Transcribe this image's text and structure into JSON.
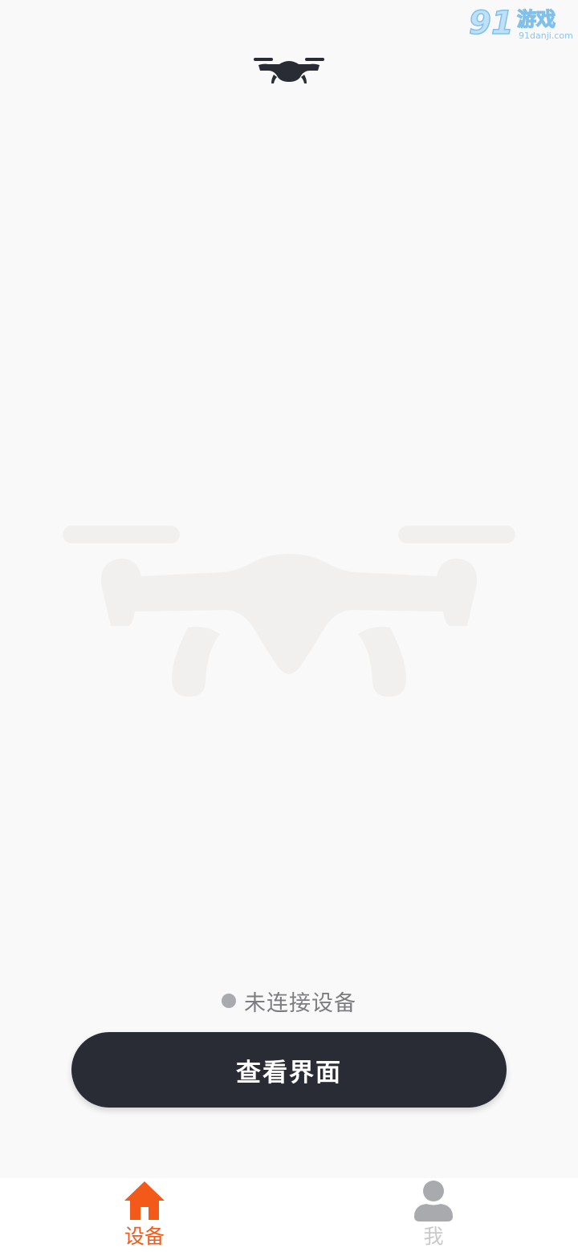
{
  "watermark": {
    "brand_number": "91",
    "brand_text": "游戏",
    "brand_url": "91danji.com"
  },
  "header": {
    "icon": "drone-icon"
  },
  "hero": {
    "icon": "drone-illustration"
  },
  "status": {
    "text": "未连接设备",
    "dot_color": "#a9aaae"
  },
  "primary_button": {
    "label": "查看界面",
    "bg_color": "#292c35"
  },
  "tabbar": {
    "tabs": [
      {
        "label": "设备",
        "icon": "home-icon",
        "active": true,
        "color": "#f35a1a"
      },
      {
        "label": "我",
        "icon": "user-icon",
        "active": false,
        "color": "#c9c9cc"
      }
    ]
  }
}
